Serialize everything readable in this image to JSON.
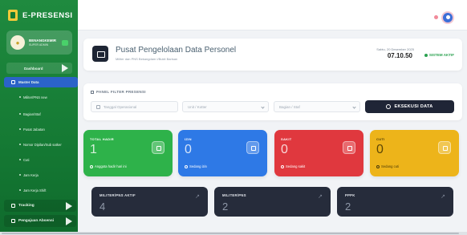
{
  "app": {
    "brand": "E-PRESENSI"
  },
  "user": {
    "name": "BENANGKEMIR",
    "role": "SUPER ADMIN"
  },
  "sidebar": {
    "dashboard": "Dashboard",
    "master": "Master Data",
    "items": [
      {
        "label": "Militer/PNS new"
      },
      {
        "label": "Bagian/Staf"
      },
      {
        "label": "Pusat Jabatan"
      },
      {
        "label": "Nomor Dipilan/Sub satker"
      },
      {
        "label": "Cuti"
      },
      {
        "label": "Jam Kerja"
      },
      {
        "label": "Jam Kerja Shift"
      }
    ],
    "tracking": "Tracking",
    "pengajuan": "Pengajuan Absensi"
  },
  "header": {
    "title": "Pusat Pengelolaan Data Personel",
    "subtitle": "Militer dan PNS Bekangdam I/Bukit Barisan",
    "date": "Sabtu, 20 Desember 2025",
    "time": "07.10.50",
    "status": "SISTEM AKTIF"
  },
  "filter": {
    "title": "PANEL FILTER PRESENSI",
    "date_placeholder": "Tanggal Operasional",
    "unit_placeholder": "Unit / Kotter",
    "bagian_placeholder": "Bagian / Staf",
    "execute_label": "EKSEKUSI DATA"
  },
  "stats": [
    {
      "label": "TOTAL HADIR",
      "value": "1",
      "foot": "Anggota hadir hari ini",
      "color": "#2eb24a"
    },
    {
      "label": "IZIN",
      "value": "0",
      "foot": "Sedang izin",
      "color": "#2e79e6"
    },
    {
      "label": "SAKIT",
      "value": "0",
      "foot": "Sedang sakit",
      "color": "#e0383e"
    },
    {
      "label": "CUTI",
      "value": "0",
      "foot": "Sedang cuti",
      "color": "#edb41a"
    }
  ],
  "totals": [
    {
      "label": "MILITER/PNS AKTIF",
      "value": "4"
    },
    {
      "label": "MILITER/PNS",
      "value": "2"
    },
    {
      "label": "PPPK",
      "value": "2"
    }
  ]
}
